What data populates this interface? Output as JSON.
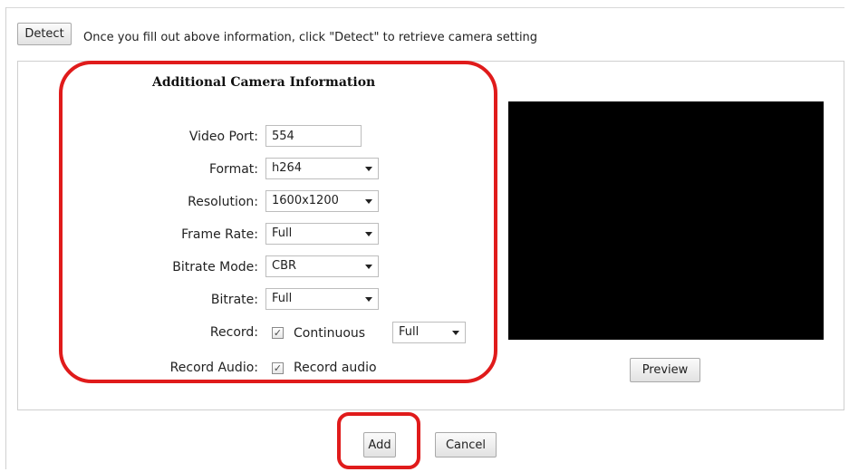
{
  "detect_button": {
    "label": "Detect"
  },
  "detect_hint": "Once you fill out above information, click \"Detect\" to retrieve camera setting",
  "section_title": "Additional Camera Information",
  "fields": {
    "video_port": {
      "label": "Video Port:",
      "value": "554"
    },
    "format": {
      "label": "Format:",
      "value": "h264"
    },
    "resolution": {
      "label": "Resolution:",
      "value": "1600x1200"
    },
    "frame_rate": {
      "label": "Frame Rate:",
      "value": "Full"
    },
    "bitrate_mode": {
      "label": "Bitrate Mode:",
      "value": "CBR"
    },
    "bitrate": {
      "label": "Bitrate:",
      "value": "Full"
    },
    "record": {
      "label": "Record:",
      "checkbox_label": "Continuous",
      "checked": true,
      "mode_value": "Full"
    },
    "record_audio": {
      "label": "Record Audio:",
      "checkbox_label": "Record audio",
      "checked": true
    }
  },
  "preview_button": {
    "label": "Preview"
  },
  "add_button": {
    "label": "Add"
  },
  "cancel_button": {
    "label": "Cancel"
  },
  "check_glyph": "✓",
  "colors": {
    "highlight": "#e01b1b",
    "preview_background": "#000000"
  }
}
